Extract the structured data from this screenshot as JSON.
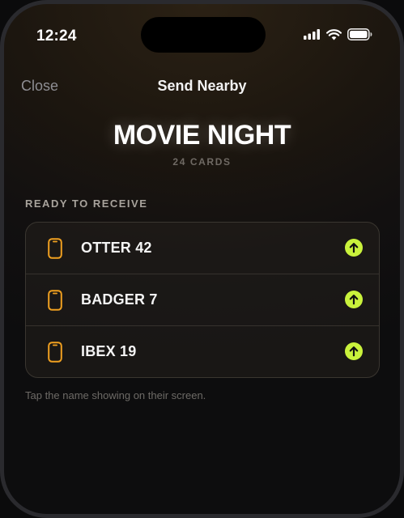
{
  "status_bar": {
    "time": "12:24",
    "icons": [
      "signal-icon",
      "wifi-icon",
      "battery-icon"
    ]
  },
  "nav": {
    "close_label": "Close",
    "title": "Send Nearby"
  },
  "deck": {
    "title": "MOVIE NIGHT",
    "count": "24 CARDS"
  },
  "receivers": {
    "section_label": "READY TO RECEIVE",
    "items": [
      {
        "name": "OTTER 42",
        "icon": "phone-icon",
        "action_icon": "send-arrow-icon"
      },
      {
        "name": "BADGER 7",
        "icon": "phone-icon",
        "action_icon": "send-arrow-icon"
      },
      {
        "name": "IBEX 19",
        "icon": "phone-icon",
        "action_icon": "send-arrow-icon"
      }
    ]
  },
  "hint": "Tap the name showing on their screen.",
  "colors": {
    "accent_orange": "#f0a020",
    "action_green": "#c9f23c",
    "background": "#1a150f"
  }
}
